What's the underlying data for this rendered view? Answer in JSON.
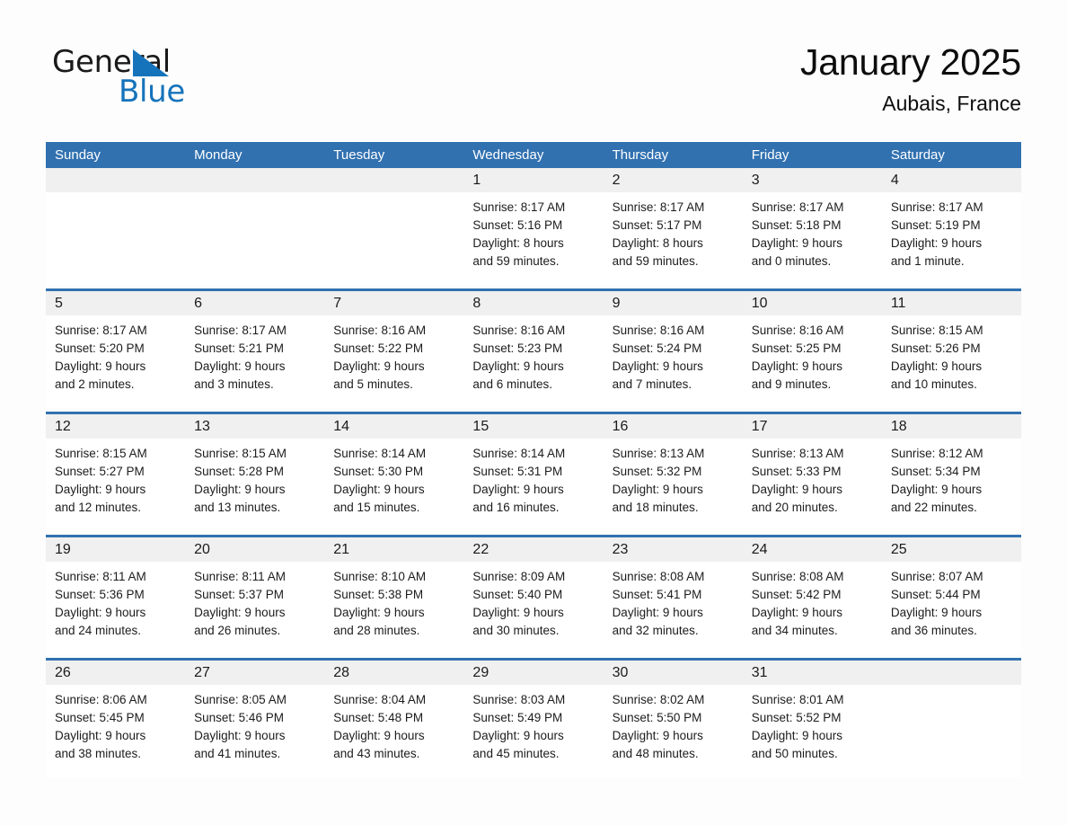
{
  "brand": {
    "name_part1": "General",
    "name_part2": "Blue",
    "triangle_icon": "triangle-icon",
    "accent_color": "#1573bb"
  },
  "header": {
    "title": "January 2025",
    "subtitle": "Aubais, France"
  },
  "theme": {
    "header_blue": "#3171b0",
    "daynum_band": "#f0f0f0",
    "page_background": "#fdfdfd",
    "text": "#1c1c1c"
  },
  "weekdays": [
    "Sunday",
    "Monday",
    "Tuesday",
    "Wednesday",
    "Thursday",
    "Friday",
    "Saturday"
  ],
  "weeks": [
    [
      {
        "day": "",
        "sunrise": "",
        "sunset": "",
        "daylight1": "",
        "daylight2": ""
      },
      {
        "day": "",
        "sunrise": "",
        "sunset": "",
        "daylight1": "",
        "daylight2": ""
      },
      {
        "day": "",
        "sunrise": "",
        "sunset": "",
        "daylight1": "",
        "daylight2": ""
      },
      {
        "day": "1",
        "sunrise": "Sunrise: 8:17 AM",
        "sunset": "Sunset: 5:16 PM",
        "daylight1": "Daylight: 8 hours",
        "daylight2": "and 59 minutes."
      },
      {
        "day": "2",
        "sunrise": "Sunrise: 8:17 AM",
        "sunset": "Sunset: 5:17 PM",
        "daylight1": "Daylight: 8 hours",
        "daylight2": "and 59 minutes."
      },
      {
        "day": "3",
        "sunrise": "Sunrise: 8:17 AM",
        "sunset": "Sunset: 5:18 PM",
        "daylight1": "Daylight: 9 hours",
        "daylight2": "and 0 minutes."
      },
      {
        "day": "4",
        "sunrise": "Sunrise: 8:17 AM",
        "sunset": "Sunset: 5:19 PM",
        "daylight1": "Daylight: 9 hours",
        "daylight2": "and 1 minute."
      }
    ],
    [
      {
        "day": "5",
        "sunrise": "Sunrise: 8:17 AM",
        "sunset": "Sunset: 5:20 PM",
        "daylight1": "Daylight: 9 hours",
        "daylight2": "and 2 minutes."
      },
      {
        "day": "6",
        "sunrise": "Sunrise: 8:17 AM",
        "sunset": "Sunset: 5:21 PM",
        "daylight1": "Daylight: 9 hours",
        "daylight2": "and 3 minutes."
      },
      {
        "day": "7",
        "sunrise": "Sunrise: 8:16 AM",
        "sunset": "Sunset: 5:22 PM",
        "daylight1": "Daylight: 9 hours",
        "daylight2": "and 5 minutes."
      },
      {
        "day": "8",
        "sunrise": "Sunrise: 8:16 AM",
        "sunset": "Sunset: 5:23 PM",
        "daylight1": "Daylight: 9 hours",
        "daylight2": "and 6 minutes."
      },
      {
        "day": "9",
        "sunrise": "Sunrise: 8:16 AM",
        "sunset": "Sunset: 5:24 PM",
        "daylight1": "Daylight: 9 hours",
        "daylight2": "and 7 minutes."
      },
      {
        "day": "10",
        "sunrise": "Sunrise: 8:16 AM",
        "sunset": "Sunset: 5:25 PM",
        "daylight1": "Daylight: 9 hours",
        "daylight2": "and 9 minutes."
      },
      {
        "day": "11",
        "sunrise": "Sunrise: 8:15 AM",
        "sunset": "Sunset: 5:26 PM",
        "daylight1": "Daylight: 9 hours",
        "daylight2": "and 10 minutes."
      }
    ],
    [
      {
        "day": "12",
        "sunrise": "Sunrise: 8:15 AM",
        "sunset": "Sunset: 5:27 PM",
        "daylight1": "Daylight: 9 hours",
        "daylight2": "and 12 minutes."
      },
      {
        "day": "13",
        "sunrise": "Sunrise: 8:15 AM",
        "sunset": "Sunset: 5:28 PM",
        "daylight1": "Daylight: 9 hours",
        "daylight2": "and 13 minutes."
      },
      {
        "day": "14",
        "sunrise": "Sunrise: 8:14 AM",
        "sunset": "Sunset: 5:30 PM",
        "daylight1": "Daylight: 9 hours",
        "daylight2": "and 15 minutes."
      },
      {
        "day": "15",
        "sunrise": "Sunrise: 8:14 AM",
        "sunset": "Sunset: 5:31 PM",
        "daylight1": "Daylight: 9 hours",
        "daylight2": "and 16 minutes."
      },
      {
        "day": "16",
        "sunrise": "Sunrise: 8:13 AM",
        "sunset": "Sunset: 5:32 PM",
        "daylight1": "Daylight: 9 hours",
        "daylight2": "and 18 minutes."
      },
      {
        "day": "17",
        "sunrise": "Sunrise: 8:13 AM",
        "sunset": "Sunset: 5:33 PM",
        "daylight1": "Daylight: 9 hours",
        "daylight2": "and 20 minutes."
      },
      {
        "day": "18",
        "sunrise": "Sunrise: 8:12 AM",
        "sunset": "Sunset: 5:34 PM",
        "daylight1": "Daylight: 9 hours",
        "daylight2": "and 22 minutes."
      }
    ],
    [
      {
        "day": "19",
        "sunrise": "Sunrise: 8:11 AM",
        "sunset": "Sunset: 5:36 PM",
        "daylight1": "Daylight: 9 hours",
        "daylight2": "and 24 minutes."
      },
      {
        "day": "20",
        "sunrise": "Sunrise: 8:11 AM",
        "sunset": "Sunset: 5:37 PM",
        "daylight1": "Daylight: 9 hours",
        "daylight2": "and 26 minutes."
      },
      {
        "day": "21",
        "sunrise": "Sunrise: 8:10 AM",
        "sunset": "Sunset: 5:38 PM",
        "daylight1": "Daylight: 9 hours",
        "daylight2": "and 28 minutes."
      },
      {
        "day": "22",
        "sunrise": "Sunrise: 8:09 AM",
        "sunset": "Sunset: 5:40 PM",
        "daylight1": "Daylight: 9 hours",
        "daylight2": "and 30 minutes."
      },
      {
        "day": "23",
        "sunrise": "Sunrise: 8:08 AM",
        "sunset": "Sunset: 5:41 PM",
        "daylight1": "Daylight: 9 hours",
        "daylight2": "and 32 minutes."
      },
      {
        "day": "24",
        "sunrise": "Sunrise: 8:08 AM",
        "sunset": "Sunset: 5:42 PM",
        "daylight1": "Daylight: 9 hours",
        "daylight2": "and 34 minutes."
      },
      {
        "day": "25",
        "sunrise": "Sunrise: 8:07 AM",
        "sunset": "Sunset: 5:44 PM",
        "daylight1": "Daylight: 9 hours",
        "daylight2": "and 36 minutes."
      }
    ],
    [
      {
        "day": "26",
        "sunrise": "Sunrise: 8:06 AM",
        "sunset": "Sunset: 5:45 PM",
        "daylight1": "Daylight: 9 hours",
        "daylight2": "and 38 minutes."
      },
      {
        "day": "27",
        "sunrise": "Sunrise: 8:05 AM",
        "sunset": "Sunset: 5:46 PM",
        "daylight1": "Daylight: 9 hours",
        "daylight2": "and 41 minutes."
      },
      {
        "day": "28",
        "sunrise": "Sunrise: 8:04 AM",
        "sunset": "Sunset: 5:48 PM",
        "daylight1": "Daylight: 9 hours",
        "daylight2": "and 43 minutes."
      },
      {
        "day": "29",
        "sunrise": "Sunrise: 8:03 AM",
        "sunset": "Sunset: 5:49 PM",
        "daylight1": "Daylight: 9 hours",
        "daylight2": "and 45 minutes."
      },
      {
        "day": "30",
        "sunrise": "Sunrise: 8:02 AM",
        "sunset": "Sunset: 5:50 PM",
        "daylight1": "Daylight: 9 hours",
        "daylight2": "and 48 minutes."
      },
      {
        "day": "31",
        "sunrise": "Sunrise: 8:01 AM",
        "sunset": "Sunset: 5:52 PM",
        "daylight1": "Daylight: 9 hours",
        "daylight2": "and 50 minutes."
      },
      {
        "day": "",
        "sunrise": "",
        "sunset": "",
        "daylight1": "",
        "daylight2": ""
      }
    ]
  ]
}
